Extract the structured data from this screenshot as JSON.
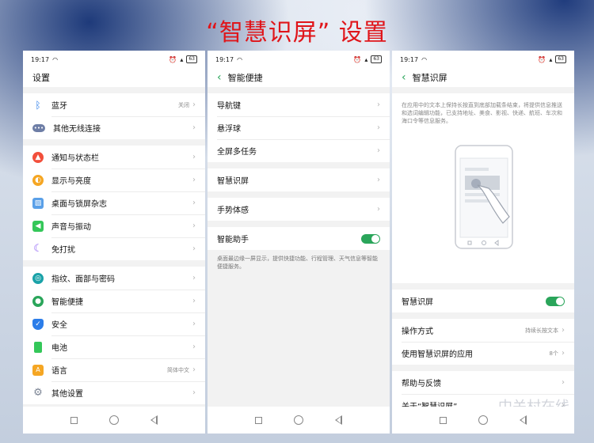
{
  "headline": "“智慧识屏” 设置",
  "status": {
    "time": "19:17",
    "battery": "63"
  },
  "screen1": {
    "title": "设置",
    "group1": [
      {
        "label": "蓝牙",
        "value": "关闭",
        "icon": "bluetooth-icon",
        "color": "#2b7de9"
      },
      {
        "label": "其他无线连接",
        "value": "",
        "icon": "dots-icon",
        "color": "#6e7ea6"
      }
    ],
    "group2": [
      {
        "label": "通知与状态栏",
        "value": "",
        "icon": "bell-icon",
        "color": "#f24f3b"
      },
      {
        "label": "显示与亮度",
        "value": "",
        "icon": "sun-icon",
        "color": "#f5a623"
      },
      {
        "label": "桌面与锁屏杂志",
        "value": "",
        "icon": "image-icon",
        "color": "#5aa0e8"
      },
      {
        "label": "声音与振动",
        "value": "",
        "icon": "speaker-icon",
        "color": "#34c759"
      },
      {
        "label": "免打扰",
        "value": "",
        "icon": "moon-icon",
        "color": "#8b5cf6"
      }
    ],
    "group3": [
      {
        "label": "指纹、面部与密码",
        "value": "",
        "icon": "fingerprint-icon",
        "color": "#1aa2a8"
      },
      {
        "label": "智能便捷",
        "value": "",
        "icon": "bulb-icon",
        "color": "#2aa55a"
      },
      {
        "label": "安全",
        "value": "",
        "icon": "shield-icon",
        "color": "#2b7de9"
      },
      {
        "label": "电池",
        "value": "",
        "icon": "battery-icon",
        "color": "#34c759"
      },
      {
        "label": "语言",
        "value": "简体中文",
        "icon": "language-icon",
        "color": "#f5a623"
      },
      {
        "label": "其他设置",
        "value": "",
        "icon": "gear-icon",
        "color": "#7b8494"
      }
    ]
  },
  "screen2": {
    "title": "智能便捷",
    "group1": [
      "导航键",
      "悬浮球",
      "全屏多任务"
    ],
    "group2": [
      "智慧识屏"
    ],
    "group3": [
      "手势体感"
    ],
    "assistant": "智能助手",
    "note": "桌面最边缘一屏显示，提供快捷功能、行程管理、天气信息等智能便捷服务。"
  },
  "screen3": {
    "title": "智慧识屏",
    "intro": "在应用中的文本上保持长按直到底部加载条结束，将提供信息推送和选词编辑功能，已支持地址、美食、影视、快递、航班、车次和海口令等信息服务。",
    "toggle_label": "智慧识屏",
    "rows": [
      {
        "label": "操作方式",
        "value": "持续长按文本"
      },
      {
        "label": "使用智慧识屏的应用",
        "value": "8个"
      }
    ],
    "group3": [
      "帮助与反馈",
      "关于“智慧识屏”"
    ]
  },
  "watermark": "中关村在线"
}
